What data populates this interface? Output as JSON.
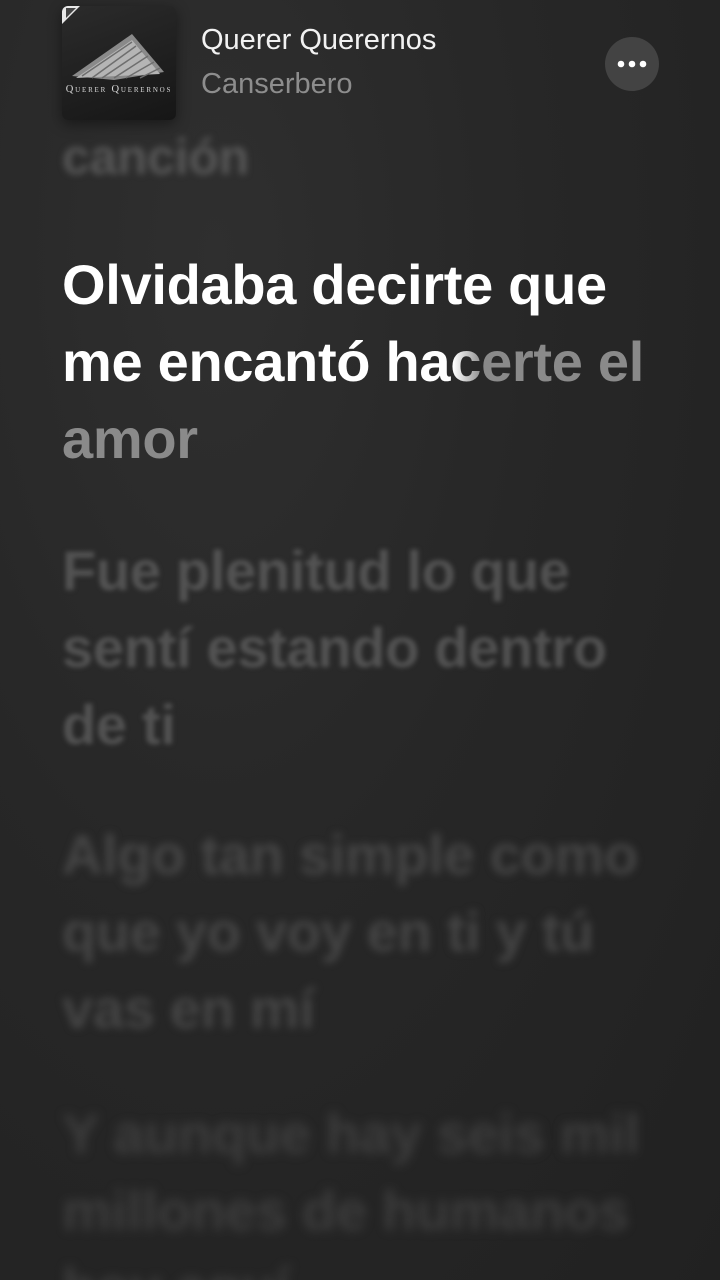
{
  "now_playing": {
    "album_art_text": "Querer Querernos",
    "title": "Querer Querernos",
    "artist": "Canserbero",
    "more_icon": "ellipsis-icon"
  },
  "lyrics": {
    "previous_line": "canción",
    "current_line": {
      "sung": "Olvidaba decirte que me encantó ha",
      "partial": "c",
      "unsung": "erte el amor"
    },
    "upcoming": [
      "Fue plenitud lo que sentí estando dentro de ti",
      "Algo tan simple como que yo voy en ti y tú vas en mí",
      "Y aunque hay seis mil millones de humanos hoy aquí"
    ]
  },
  "colors": {
    "background": "#262626",
    "highlight": "#ffffff",
    "dim_text": "#8a8a8a",
    "artist_text": "#8d8d8d",
    "button_bg": "#434343"
  }
}
